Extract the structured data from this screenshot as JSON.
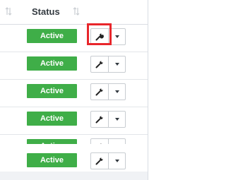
{
  "header": {
    "status_label": "Status"
  },
  "rows": [
    {
      "status": "Active"
    },
    {
      "status": "Active"
    },
    {
      "status": "Active"
    },
    {
      "status": "Active"
    },
    {
      "status": "Active"
    },
    {
      "status": "Active"
    }
  ],
  "colors": {
    "status_active": "#3fae48",
    "highlight": "#e8262b"
  },
  "icons": {
    "sort": "sort-arrows-icon",
    "action": "wrench-icon",
    "dropdown": "caret-down-icon"
  }
}
